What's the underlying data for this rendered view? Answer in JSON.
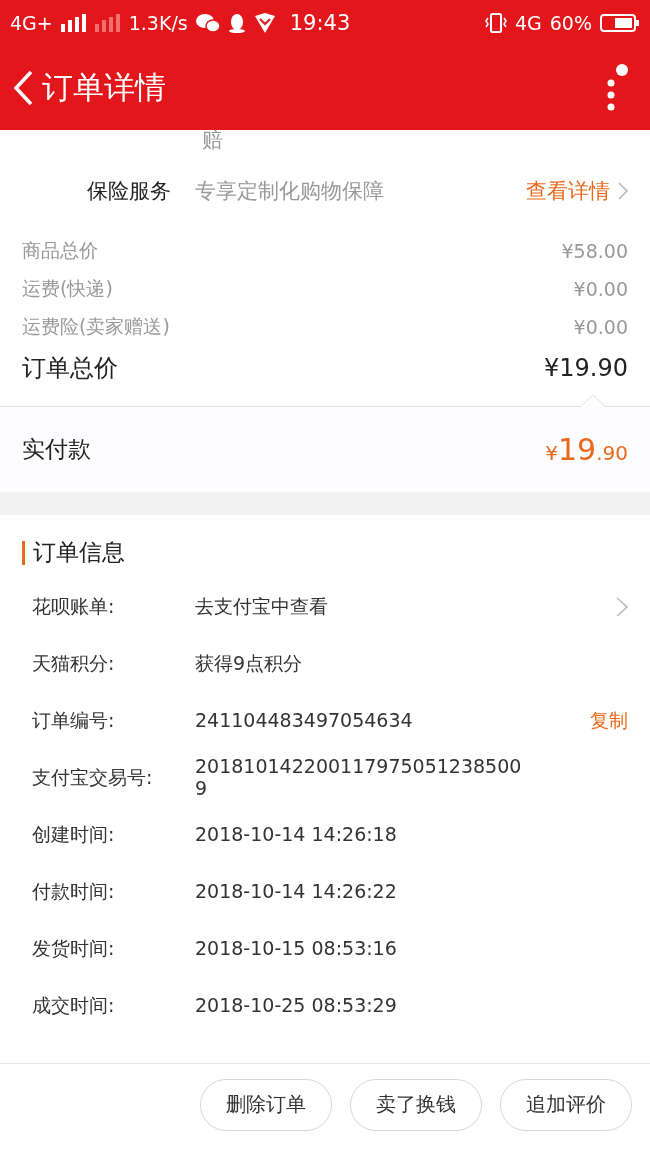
{
  "status_bar": {
    "network_left": "4G+",
    "speed": "1.3K/s",
    "time": "19:43",
    "network_right": "4G",
    "battery": "60%"
  },
  "header": {
    "title": "订单详情"
  },
  "cut_row": {
    "text": "赔"
  },
  "insurance": {
    "label": "保险服务",
    "value": "专享定制化购物保障",
    "action": "查看详情"
  },
  "price_lines": [
    {
      "label": "商品总价",
      "value": "¥58.00"
    },
    {
      "label": "运费(快递)",
      "value": "¥0.00"
    },
    {
      "label": "运费险(卖家赠送)",
      "value": "¥0.00"
    }
  ],
  "order_total": {
    "label": "订单总价",
    "value": "¥19.90"
  },
  "paid": {
    "label": "实付款",
    "currency": "¥",
    "integer": "19",
    "decimal": ".90"
  },
  "order_info": {
    "title": "订单信息",
    "rows": [
      {
        "label": "花呗账单:",
        "value": "去支付宝中查看",
        "kind": "link"
      },
      {
        "label": "天猫积分:",
        "value": "获得9点积分",
        "kind": "plain"
      },
      {
        "label": "订单编号:",
        "value": "241104483497054634",
        "kind": "copy",
        "action": "复制"
      },
      {
        "label": "支付宝交易号:",
        "value": "2018101422001179750512385009",
        "kind": "plain"
      },
      {
        "label": "创建时间:",
        "value": "2018-10-14 14:26:18",
        "kind": "plain"
      },
      {
        "label": "付款时间:",
        "value": "2018-10-14 14:26:22",
        "kind": "plain"
      },
      {
        "label": "发货时间:",
        "value": "2018-10-15 08:53:16",
        "kind": "plain"
      },
      {
        "label": "成交时间:",
        "value": "2018-10-25 08:53:29",
        "kind": "plain"
      }
    ]
  },
  "buttons": [
    "删除订单",
    "卖了换钱",
    "追加评价"
  ]
}
